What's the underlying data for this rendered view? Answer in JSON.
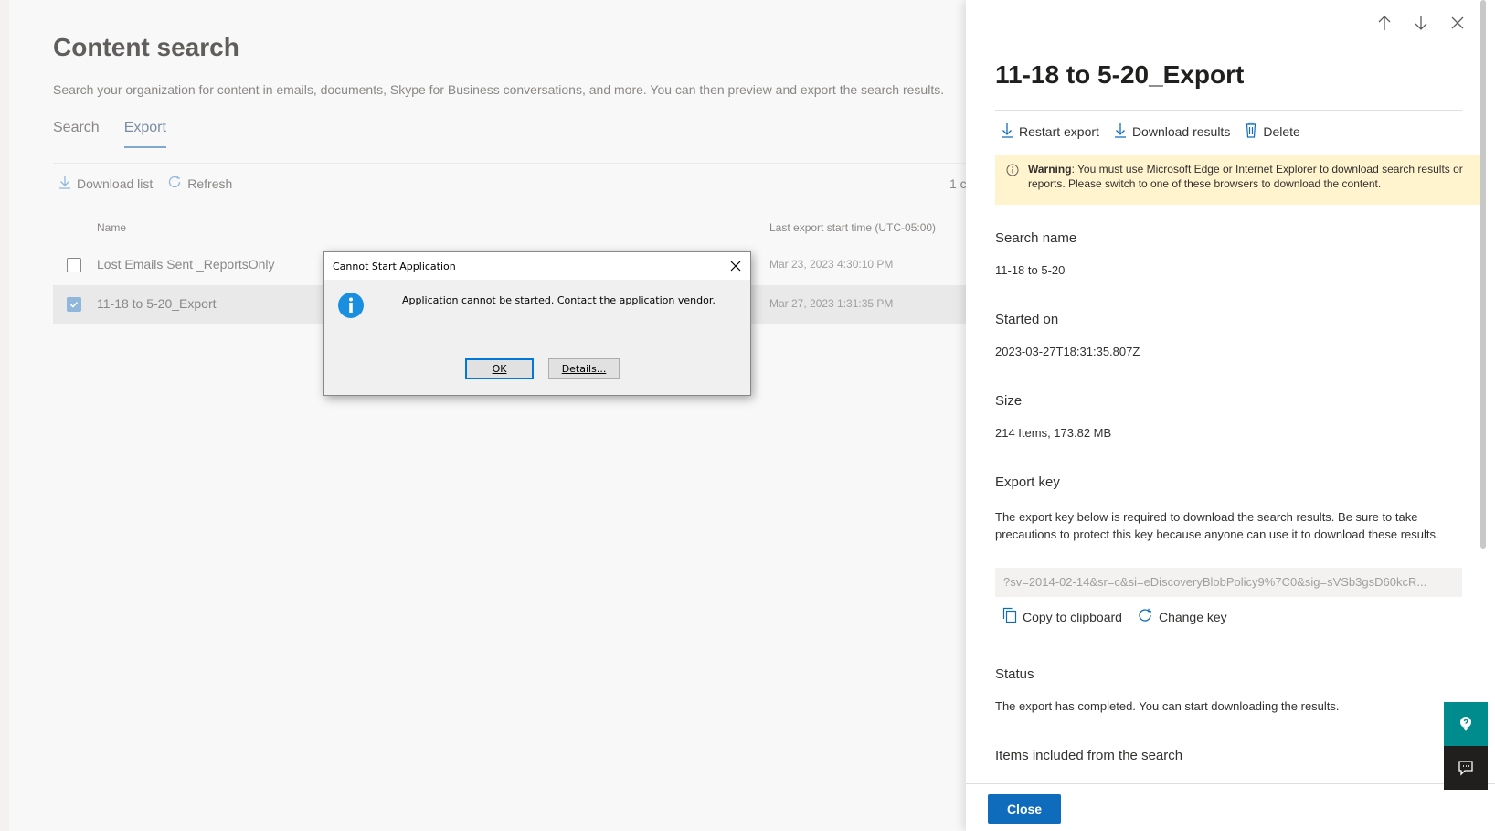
{
  "page": {
    "title": "Content search",
    "subtitle": "Search your organization for content in emails, documents, Skype for Business conversations, and more. You can then preview and export the search results.",
    "tabs": [
      {
        "label": "Search",
        "active": false
      },
      {
        "label": "Export",
        "active": true
      }
    ],
    "commands": {
      "download_list": "Download list",
      "refresh": "Refresh"
    },
    "count_text": "1 c",
    "table": {
      "headers": {
        "name": "Name",
        "last_export": "Last export start time (UTC-05:00)"
      },
      "rows": [
        {
          "name": "Lost Emails Sent _ReportsOnly",
          "date": "Mar 23, 2023 4:30:10 PM",
          "selected": false
        },
        {
          "name": "11-18 to 5-20_Export",
          "date": "Mar 27, 2023 1:31:35 PM",
          "selected": true
        }
      ]
    }
  },
  "panel": {
    "title": "11-18 to 5-20_Export",
    "commands": {
      "restart_export": "Restart export",
      "download_results": "Download results",
      "delete": "Delete"
    },
    "warning": {
      "label": "Warning",
      "text": ": You must use Microsoft Edge or Internet Explorer to download search results or reports. Please switch to one of these browsers to download the content.",
      "bg_color": "#fff4ce"
    },
    "search_name": {
      "label": "Search name",
      "value": "11-18 to 5-20"
    },
    "started_on": {
      "label": "Started on",
      "value": "2023-03-27T18:31:35.807Z"
    },
    "size": {
      "label": "Size",
      "value": "214 Items, 173.82 MB"
    },
    "export_key": {
      "label": "Export key",
      "description": "The export key below is required to download the search results. Be sure to take precautions to protect this key because anyone can use it to download these results.",
      "value": "?sv=2014-02-14&sr=c&si=eDiscoveryBlobPolicy9%7C0&sig=sVSb3gsD60kcR...",
      "copy_label": "Copy to clipboard",
      "change_label": "Change key"
    },
    "status": {
      "label": "Status",
      "value": "The export has completed. You can start downloading the results."
    },
    "items_included": {
      "label": "Items included from the search"
    },
    "close_label": "Close",
    "accent_color": "#0f6cbd"
  },
  "dialog": {
    "title": "Cannot Start Application",
    "message": "Application cannot be started. Contact the application vendor.",
    "ok_label": "OK",
    "details_label": "Details...",
    "icon": "info-icon"
  },
  "floating": {
    "help_icon": "help-icon",
    "feedback_icon": "feedback-icon"
  }
}
